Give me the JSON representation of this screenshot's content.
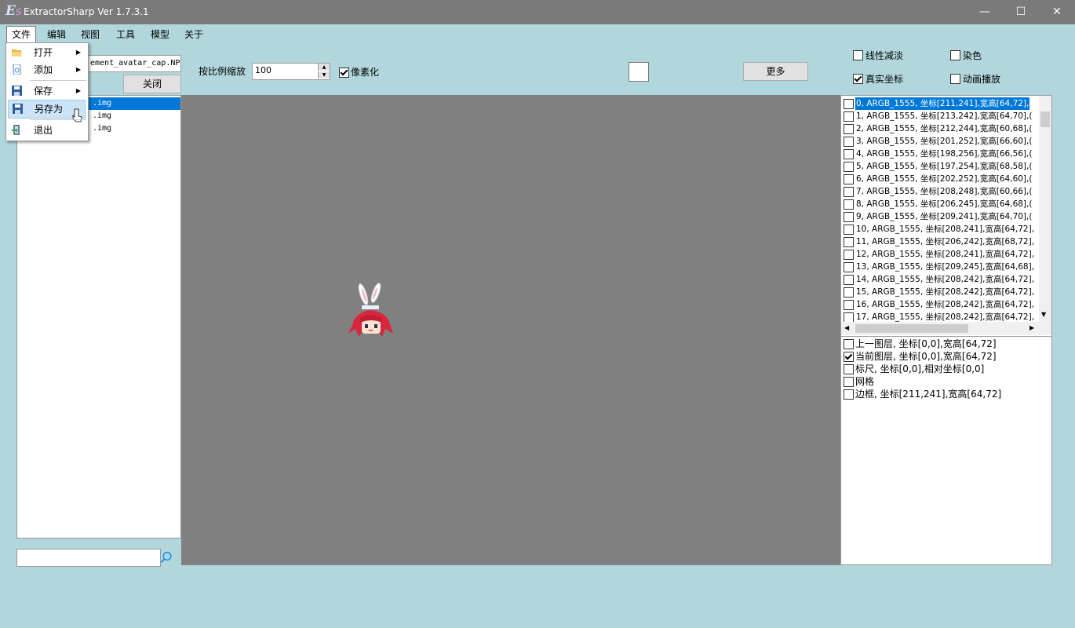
{
  "window": {
    "title": "ExtractorSharp Ver 1.7.3.1",
    "logo_main": "E",
    "logo_sub": "S",
    "minimize": "—",
    "maximize": "☐",
    "close": "✕"
  },
  "menu": [
    "文件",
    "编辑",
    "视图",
    "工具",
    "模型",
    "关于"
  ],
  "file_menu": {
    "open": "打开",
    "add": "添加",
    "save": "保存",
    "save_as": "另存为",
    "exit": "退出"
  },
  "left_panel": {
    "file_path": "ement_avatar_cap.NPK",
    "close_label": "关闭",
    "files": [
      ".img",
      ".img",
      ".img"
    ],
    "selected_index": 0,
    "search_value": ""
  },
  "toolbar": {
    "scale_label": "按比例缩放",
    "scale_value": "100",
    "pixelate_label": "像素化",
    "pixelate_checked": true,
    "more_label": "更多",
    "linear_fade_label": "线性减淡",
    "linear_fade_checked": false,
    "dye_label": "染色",
    "dye_checked": false,
    "real_coords_label": "真实坐标",
    "real_coords_checked": true,
    "animation_label": "动画播放",
    "animation_checked": false
  },
  "frames": [
    "0, ARGB_1555, 坐标[211,241],宽高[64,72],",
    "1, ARGB_1555, 坐标[213,242],宽高[64,70],(",
    "2, ARGB_1555, 坐标[212,244],宽高[60,68],(",
    "3, ARGB_1555, 坐标[201,252],宽高[66,60],(",
    "4, ARGB_1555, 坐标[198,256],宽高[66,56],(",
    "5, ARGB_1555, 坐标[197,254],宽高[68,58],(",
    "6, ARGB_1555, 坐标[202,252],宽高[64,60],(",
    "7, ARGB_1555, 坐标[208,248],宽高[60,66],(",
    "8, ARGB_1555, 坐标[206,245],宽高[64,68],(",
    "9, ARGB_1555, 坐标[209,241],宽高[64,70],(",
    "10, ARGB_1555, 坐标[208,241],宽高[64,72],",
    "11, ARGB_1555, 坐标[206,242],宽高[68,72],",
    "12, ARGB_1555, 坐标[208,241],宽高[64,72],",
    "13, ARGB_1555, 坐标[209,245],宽高[64,68],",
    "14, ARGB_1555, 坐标[208,242],宽高[64,72],",
    "15, ARGB_1555, 坐标[208,242],宽高[64,72],",
    "16, ARGB_1555, 坐标[208,242],宽高[64,72],",
    "17, ARGB_1555, 坐标[208,242],宽高[64,72],"
  ],
  "selected_frame": 0,
  "layers": [
    {
      "label": "上一图层, 坐标[0,0],宽高[64,72]",
      "checked": false
    },
    {
      "label": "当前图层, 坐标[0,0],宽高[64,72]",
      "checked": true
    },
    {
      "label": "标尺, 坐标[0,0],相对坐标[0,0]",
      "checked": false
    },
    {
      "label": "网格",
      "checked": false
    },
    {
      "label": "边框, 坐标[211,241],宽高[64,72]",
      "checked": false
    }
  ],
  "colors": {
    "background": "#b1d7dd",
    "canvas": "#808080",
    "selection": "#0078d7",
    "titlebar": "#7a7a7a"
  }
}
